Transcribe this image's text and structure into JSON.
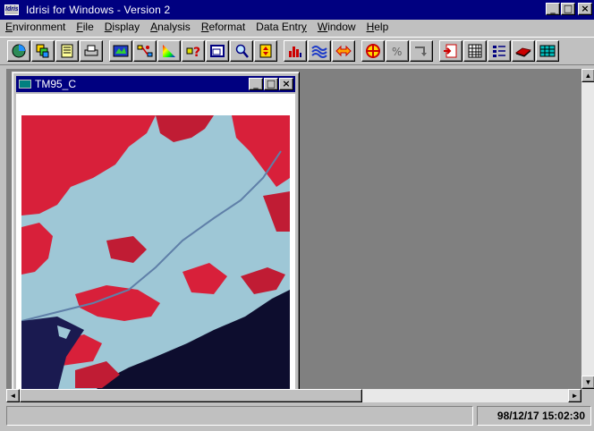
{
  "window": {
    "app_icon_text": "Idrisi",
    "title": "Idrisi for Windows  -  Version 2",
    "buttons": {
      "minimize": "_",
      "maximize": "□",
      "close": "×"
    }
  },
  "menu": [
    {
      "key": "E",
      "rest": "nvironment"
    },
    {
      "key": "F",
      "rest": "ile"
    },
    {
      "key": "D",
      "rest": "isplay"
    },
    {
      "key": "A",
      "rest": "nalysis"
    },
    {
      "key": "R",
      "rest": "eformat"
    },
    {
      "pre": "Data Entr",
      "key": "y",
      "rest": ""
    },
    {
      "key": "W",
      "rest": "indow"
    },
    {
      "key": "H",
      "rest": "elp"
    }
  ],
  "toolbar": {
    "icons": [
      "display-icon",
      "layers-icon",
      "list-icon",
      "print-icon",
      "composite-icon",
      "network-icon",
      "palette-icon",
      "query-icon",
      "window-icon",
      "zoom-icon",
      "scroll-icon",
      "histogram-icon",
      "contour-icon",
      "swap-icon",
      "target-icon",
      "percent-icon",
      "arrow-icon",
      "import-icon",
      "table-icon",
      "legend-icon",
      "layer-icon",
      "grid-icon"
    ]
  },
  "image_window": {
    "title": "TM95_C",
    "buttons": {
      "minimize": "_",
      "maximize": "□",
      "close": "×"
    }
  },
  "scroll": {
    "left": "◄",
    "right": "►",
    "up": "▲",
    "down": "▼"
  },
  "status": {
    "datetime": "98/12/17 15:02:30"
  },
  "colors": {
    "title_active": "#000080",
    "face": "#c0c0c0",
    "mdi_bg": "#808080",
    "vegetation": "#d8203a",
    "urban": "#9ec7d6",
    "water": "#0d0d2e"
  }
}
